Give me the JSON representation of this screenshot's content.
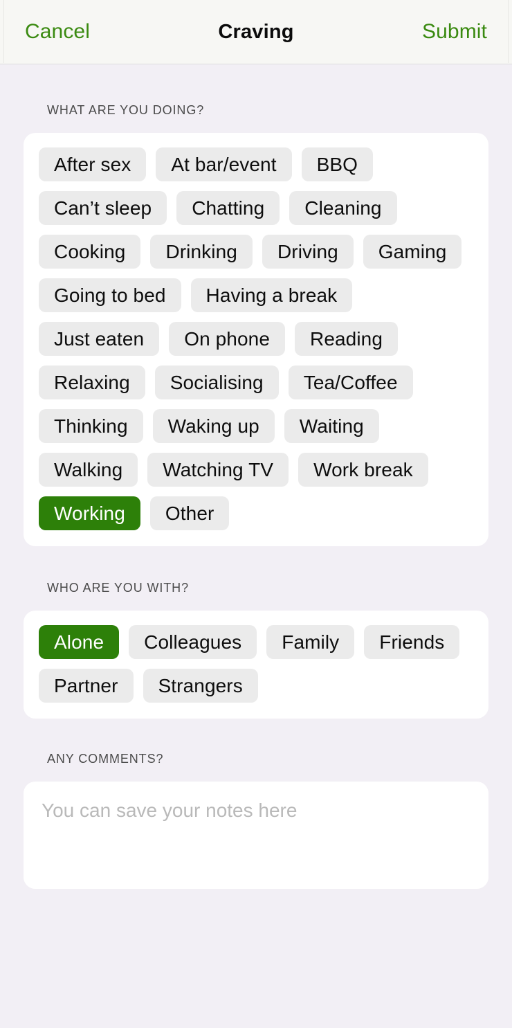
{
  "header": {
    "cancel_label": "Cancel",
    "title": "Craving",
    "submit_label": "Submit"
  },
  "theme": {
    "accent_green": "#3a8a10",
    "selected_chip_green": "#2d8009",
    "chip_gray": "#ebebeb",
    "page_background": "#f2eff5",
    "card_white": "#ffffff",
    "label_gray": "#4b4b4b",
    "placeholder_gray": "#b9b9b9"
  },
  "sections": {
    "activity": {
      "label": "WHAT ARE YOU DOING?",
      "options": [
        {
          "label": "After sex",
          "selected": false
        },
        {
          "label": "At bar/event",
          "selected": false
        },
        {
          "label": "BBQ",
          "selected": false
        },
        {
          "label": "Can’t sleep",
          "selected": false
        },
        {
          "label": "Chatting",
          "selected": false
        },
        {
          "label": "Cleaning",
          "selected": false
        },
        {
          "label": "Cooking",
          "selected": false
        },
        {
          "label": "Drinking",
          "selected": false
        },
        {
          "label": "Driving",
          "selected": false
        },
        {
          "label": "Gaming",
          "selected": false
        },
        {
          "label": "Going to bed",
          "selected": false
        },
        {
          "label": "Having a break",
          "selected": false
        },
        {
          "label": "Just eaten",
          "selected": false
        },
        {
          "label": "On phone",
          "selected": false
        },
        {
          "label": "Reading",
          "selected": false
        },
        {
          "label": "Relaxing",
          "selected": false
        },
        {
          "label": "Socialising",
          "selected": false
        },
        {
          "label": "Tea/Coffee",
          "selected": false
        },
        {
          "label": "Thinking",
          "selected": false
        },
        {
          "label": "Waking up",
          "selected": false
        },
        {
          "label": "Waiting",
          "selected": false
        },
        {
          "label": "Walking",
          "selected": false
        },
        {
          "label": "Watching TV",
          "selected": false
        },
        {
          "label": "Work break",
          "selected": false
        },
        {
          "label": "Working",
          "selected": true
        },
        {
          "label": "Other",
          "selected": false
        }
      ]
    },
    "company": {
      "label": "WHO ARE YOU WITH?",
      "options": [
        {
          "label": "Alone",
          "selected": true
        },
        {
          "label": "Colleagues",
          "selected": false
        },
        {
          "label": "Family",
          "selected": false
        },
        {
          "label": "Friends",
          "selected": false
        },
        {
          "label": "Partner",
          "selected": false
        },
        {
          "label": "Strangers",
          "selected": false
        }
      ]
    },
    "comments": {
      "label": "ANY COMMENTS?",
      "placeholder": "You can save your notes here",
      "value": ""
    }
  }
}
